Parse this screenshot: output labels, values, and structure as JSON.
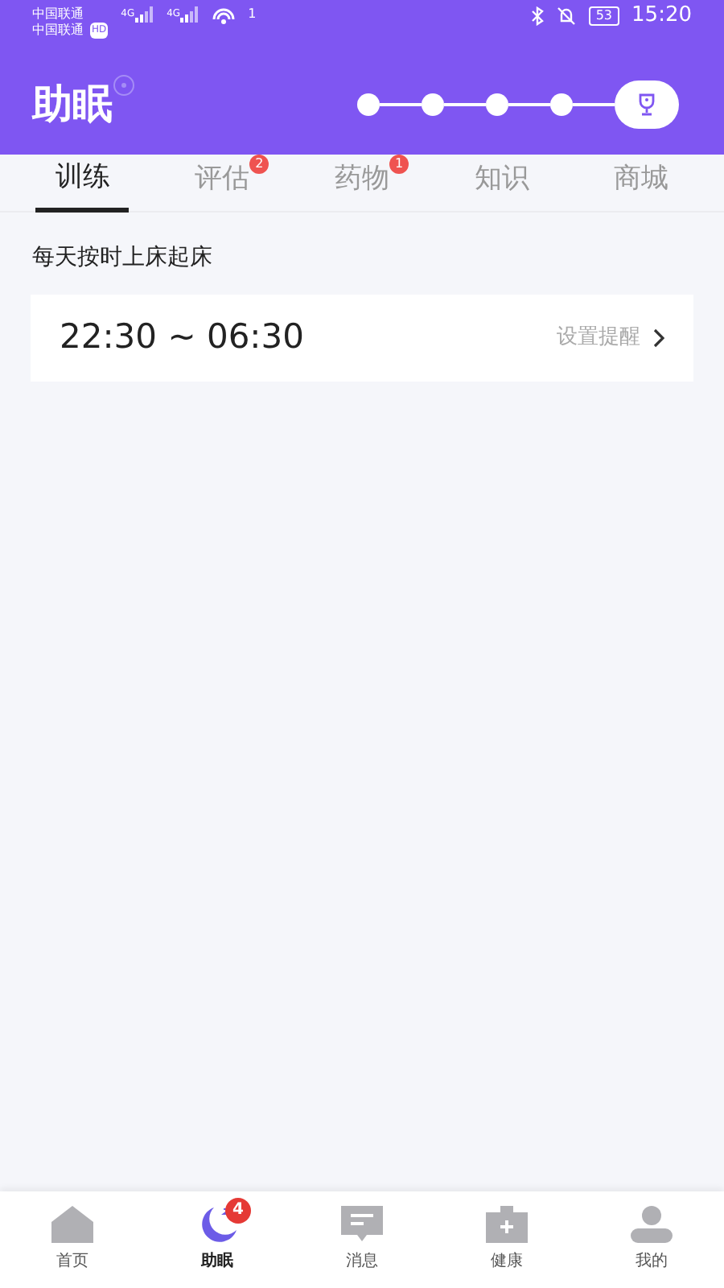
{
  "status_bar": {
    "carriers": [
      "中国联通",
      "中国联通"
    ],
    "hd": "HD",
    "signals": [
      "4G",
      "4G"
    ],
    "hotspot_count": "1",
    "battery": "53",
    "time": "15:20"
  },
  "header": {
    "title": "助眠",
    "steps": [
      {
        "kind": "dot"
      },
      {
        "kind": "dot"
      },
      {
        "kind": "dot"
      },
      {
        "kind": "dot"
      },
      {
        "kind": "trophy"
      }
    ]
  },
  "tabs": [
    {
      "label": "训练",
      "selected": true
    },
    {
      "label": "评估",
      "selected": false,
      "badge": "2"
    },
    {
      "label": "药物",
      "selected": false,
      "badge": "1"
    },
    {
      "label": "知识",
      "selected": false
    },
    {
      "label": "商城",
      "selected": false
    }
  ],
  "section_title": "每天按时上床起床",
  "schedule": {
    "time_range": "22:30 ~ 06:30",
    "action": "设置提醒"
  },
  "bottom_nav": [
    {
      "label": "首页",
      "kind": "home",
      "selected": false
    },
    {
      "label": "助眠",
      "kind": "moon",
      "selected": true,
      "badge": "4"
    },
    {
      "label": "消息",
      "kind": "message",
      "selected": false
    },
    {
      "label": "健康",
      "kind": "health",
      "selected": false
    },
    {
      "label": "我的",
      "kind": "person",
      "selected": false
    }
  ]
}
